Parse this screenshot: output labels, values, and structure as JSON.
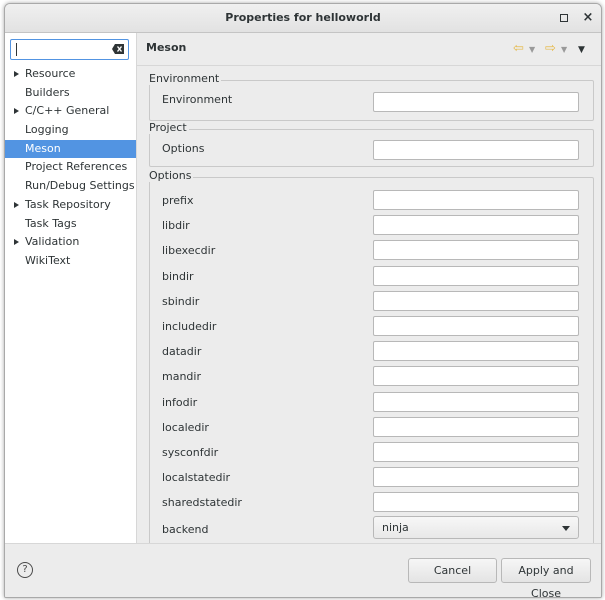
{
  "window": {
    "title": "Properties for helloworld"
  },
  "sidebar": {
    "filter": {
      "value": "",
      "placeholder": ""
    },
    "items": [
      {
        "label": "Resource",
        "expandable": true
      },
      {
        "label": "Builders",
        "expandable": false
      },
      {
        "label": "C/C++ General",
        "expandable": true
      },
      {
        "label": "Logging",
        "expandable": false
      },
      {
        "label": "Meson",
        "expandable": false,
        "selected": true
      },
      {
        "label": "Project References",
        "expandable": false
      },
      {
        "label": "Run/Debug Settings",
        "expandable": false
      },
      {
        "label": "Task Repository",
        "expandable": true
      },
      {
        "label": "Task Tags",
        "expandable": false
      },
      {
        "label": "Validation",
        "expandable": true
      },
      {
        "label": "WikiText",
        "expandable": false
      }
    ]
  },
  "page": {
    "title": "Meson",
    "groups": {
      "environment": {
        "label": "Environment",
        "row_label": "Environment",
        "value": ""
      },
      "project": {
        "label": "Project",
        "row_label": "Options",
        "value": ""
      },
      "options": {
        "label": "Options",
        "rows": [
          {
            "label": "prefix",
            "value": ""
          },
          {
            "label": "libdir",
            "value": ""
          },
          {
            "label": "libexecdir",
            "value": ""
          },
          {
            "label": "bindir",
            "value": ""
          },
          {
            "label": "sbindir",
            "value": ""
          },
          {
            "label": "includedir",
            "value": ""
          },
          {
            "label": "datadir",
            "value": ""
          },
          {
            "label": "mandir",
            "value": ""
          },
          {
            "label": "infodir",
            "value": ""
          },
          {
            "label": "localedir",
            "value": ""
          },
          {
            "label": "sysconfdir",
            "value": ""
          },
          {
            "label": "localstatedir",
            "value": ""
          },
          {
            "label": "sharedstatedir",
            "value": ""
          }
        ],
        "backend": {
          "label": "backend",
          "value": "ninja"
        }
      }
    }
  },
  "footer": {
    "help_icon": "?",
    "cancel_label": "Cancel",
    "apply_label": "Apply and Close"
  },
  "colors": {
    "selection": "#5294e2",
    "nav_arrow": "#e5b94a"
  }
}
